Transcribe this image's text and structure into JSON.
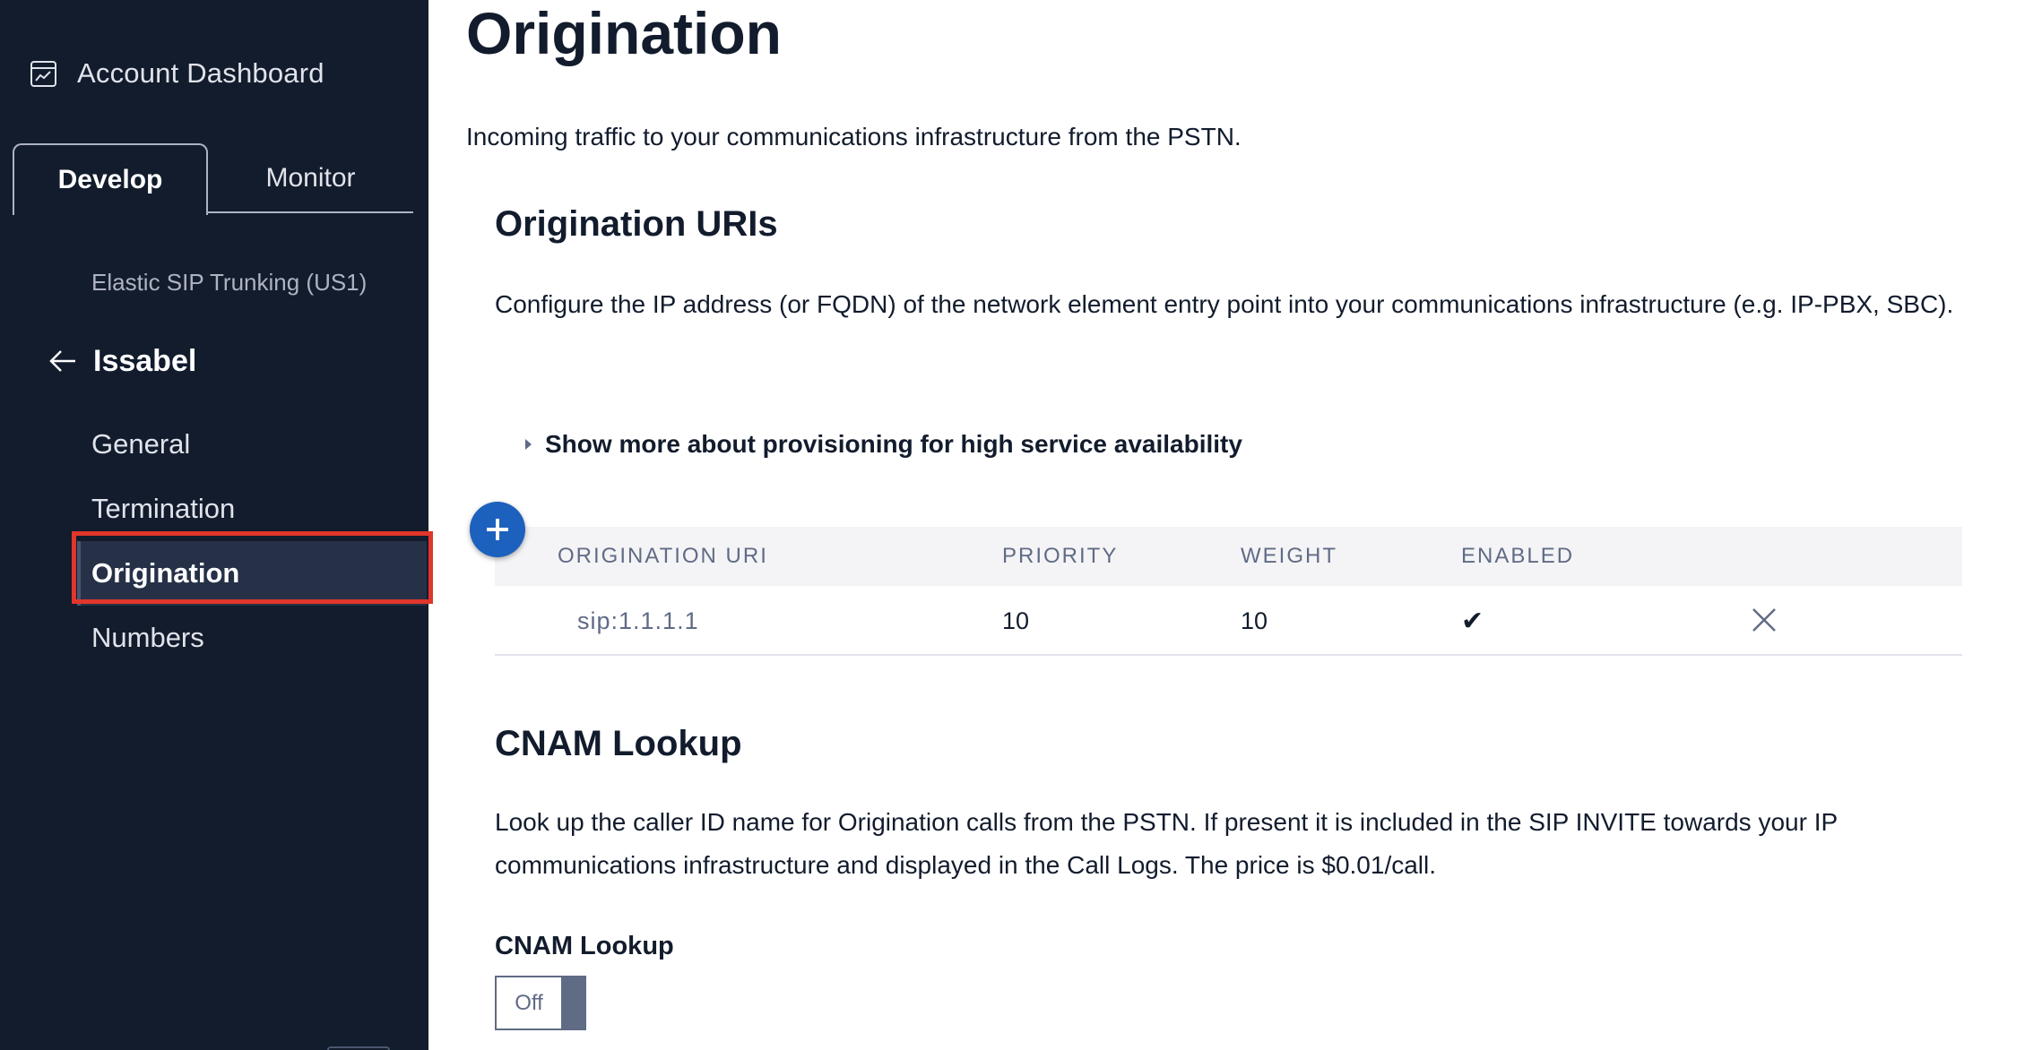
{
  "sidebar": {
    "account_dashboard": "Account Dashboard",
    "tabs": [
      {
        "label": "Develop",
        "active": true
      },
      {
        "label": "Monitor",
        "active": false
      }
    ],
    "product": "Elastic SIP Trunking (US1)",
    "trunk_name": "Issabel",
    "items": [
      {
        "label": "General"
      },
      {
        "label": "Termination"
      },
      {
        "label": "Origination",
        "active": true
      },
      {
        "label": "Numbers"
      }
    ]
  },
  "main": {
    "title": "Origination",
    "description": "Incoming traffic to your communications infrastructure from the PSTN.",
    "uris_section": {
      "heading": "Origination URIs",
      "text": "Configure the IP address (or FQDN) of the network element entry point into your communications infrastructure (e.g. IP-PBX, SBC).",
      "disclosure": "Show more about provisioning for high service availability"
    },
    "table": {
      "columns": [
        "ORIGINATION URI",
        "PRIORITY",
        "WEIGHT",
        "ENABLED"
      ],
      "rows": [
        {
          "uri": "sip:1.1.1.1",
          "priority": "10",
          "weight": "10",
          "enabled": "✔"
        }
      ]
    },
    "cnam_section": {
      "heading": "CNAM Lookup",
      "text": "Look up the caller ID name for Origination calls from the PSTN. If present it is included in the SIP INVITE towards your IP communications infrastructure and displayed in the Call Logs. The price is $0.01/call.",
      "field_label": "CNAM Lookup",
      "toggle_value": "Off"
    }
  },
  "colors": {
    "sidebar_bg": "#121c2d",
    "active_item_bg": "#263148",
    "highlight": "#e0362b",
    "add_button": "#1c61bd"
  },
  "icons": {
    "account": "chart-window-icon",
    "back": "arrow-left-icon",
    "disclosure": "triangle-right-icon",
    "add": "plus-icon",
    "delete": "close-icon"
  }
}
